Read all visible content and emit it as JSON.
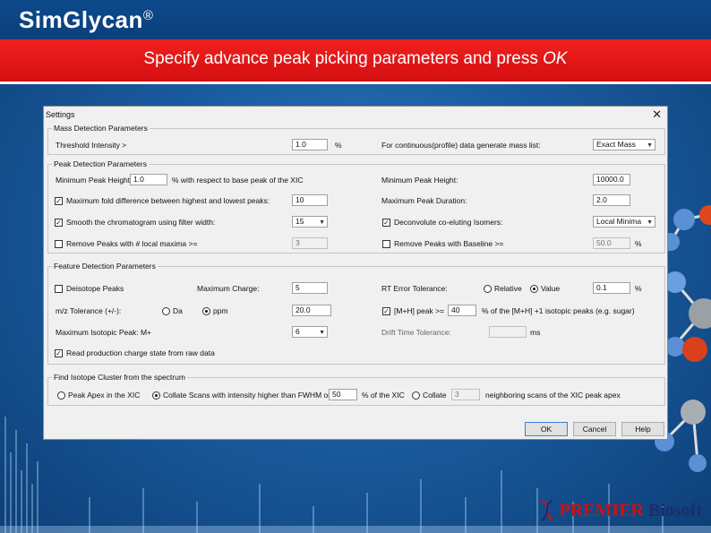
{
  "app": {
    "title": "SimGlycan",
    "reg": "®"
  },
  "banner": {
    "text": "Specify advance peak picking parameters and press ",
    "emphasis": "OK"
  },
  "logo": {
    "part1": "PREMIER",
    "part2": "Biosoft"
  },
  "dialog": {
    "title": "Settings",
    "close": "✕",
    "mass_detection": {
      "group_label": "Mass Detection Parameters",
      "threshold_label": "Threshold Intensity >",
      "threshold_value": "1.0",
      "threshold_unit": "%",
      "continuous_label": "For continuous(profile) data generate mass list:",
      "continuous_value": "Exact Mass"
    },
    "peak_detection": {
      "group_label": "Peak Detection Parameters",
      "min_peak_height_label": "Minimum Peak Height:",
      "min_peak_height_value": "1.0",
      "min_peak_height_suffix": "% with respect to base peak of the XIC",
      "min_peak_height2_label": "Minimum Peak Height:",
      "min_peak_height2_value": "10000.0",
      "max_fold_label": "Maximum fold difference between highest and lowest peaks:",
      "max_fold_value": "10",
      "max_duration_label": "Maximum Peak Duration:",
      "max_duration_value": "2.0",
      "smooth_label": "Smooth the chromatogram using filter width:",
      "smooth_value": "15",
      "deconvolute_label": "Deconvolute co-eluting Isomers:",
      "deconvolute_value": "Local Minima",
      "remove_local_label": "Remove Peaks with # local maxima  >=",
      "remove_local_value": "3",
      "remove_baseline_label": "Remove Peaks with Baseline  >=",
      "remove_baseline_value": "50.0",
      "remove_baseline_unit": "%"
    },
    "feature_detection": {
      "group_label": "Feature Detection Parameters",
      "deisotope_label": "Deisotope Peaks",
      "max_charge_label": "Maximum Charge:",
      "max_charge_value": "5",
      "rt_label": "RT Error Tolerance:",
      "rt_relative": "Relative",
      "rt_value_label": "Value",
      "rt_value": "0.1",
      "rt_unit": "%",
      "mz_label": "m/z Tolerance (+/-):",
      "mz_da": "Da",
      "mz_ppm": "ppm",
      "mz_value": "20.0",
      "mh_label": "[M+H] peak >=",
      "mh_value": "40",
      "mh_suffix": "% of the [M+H] +1 isotopic peaks (e.g. sugar)",
      "max_iso_label": "Maximum Isotopic Peak: M+",
      "max_iso_value": "6",
      "drift_label": "Drift Time Tolerance:",
      "drift_value": "",
      "drift_unit": "ms",
      "read_charge_label": "Read production charge state from raw data"
    },
    "isotope_cluster": {
      "group_label": "Find Isotope Cluster from the spectrum",
      "peak_apex_label": "Peak Apex in the XIC",
      "collate_label": "Collate Scans with intensity higher than FWHM or",
      "collate_value": "50",
      "collate_suffix": "% of the XIC",
      "collate2_label": "Collate",
      "collate2_value": "3",
      "collate2_suffix": "neighboring scans of the XIC peak apex"
    },
    "buttons": {
      "ok": "OK",
      "cancel": "Cancel",
      "help": "Help"
    }
  }
}
